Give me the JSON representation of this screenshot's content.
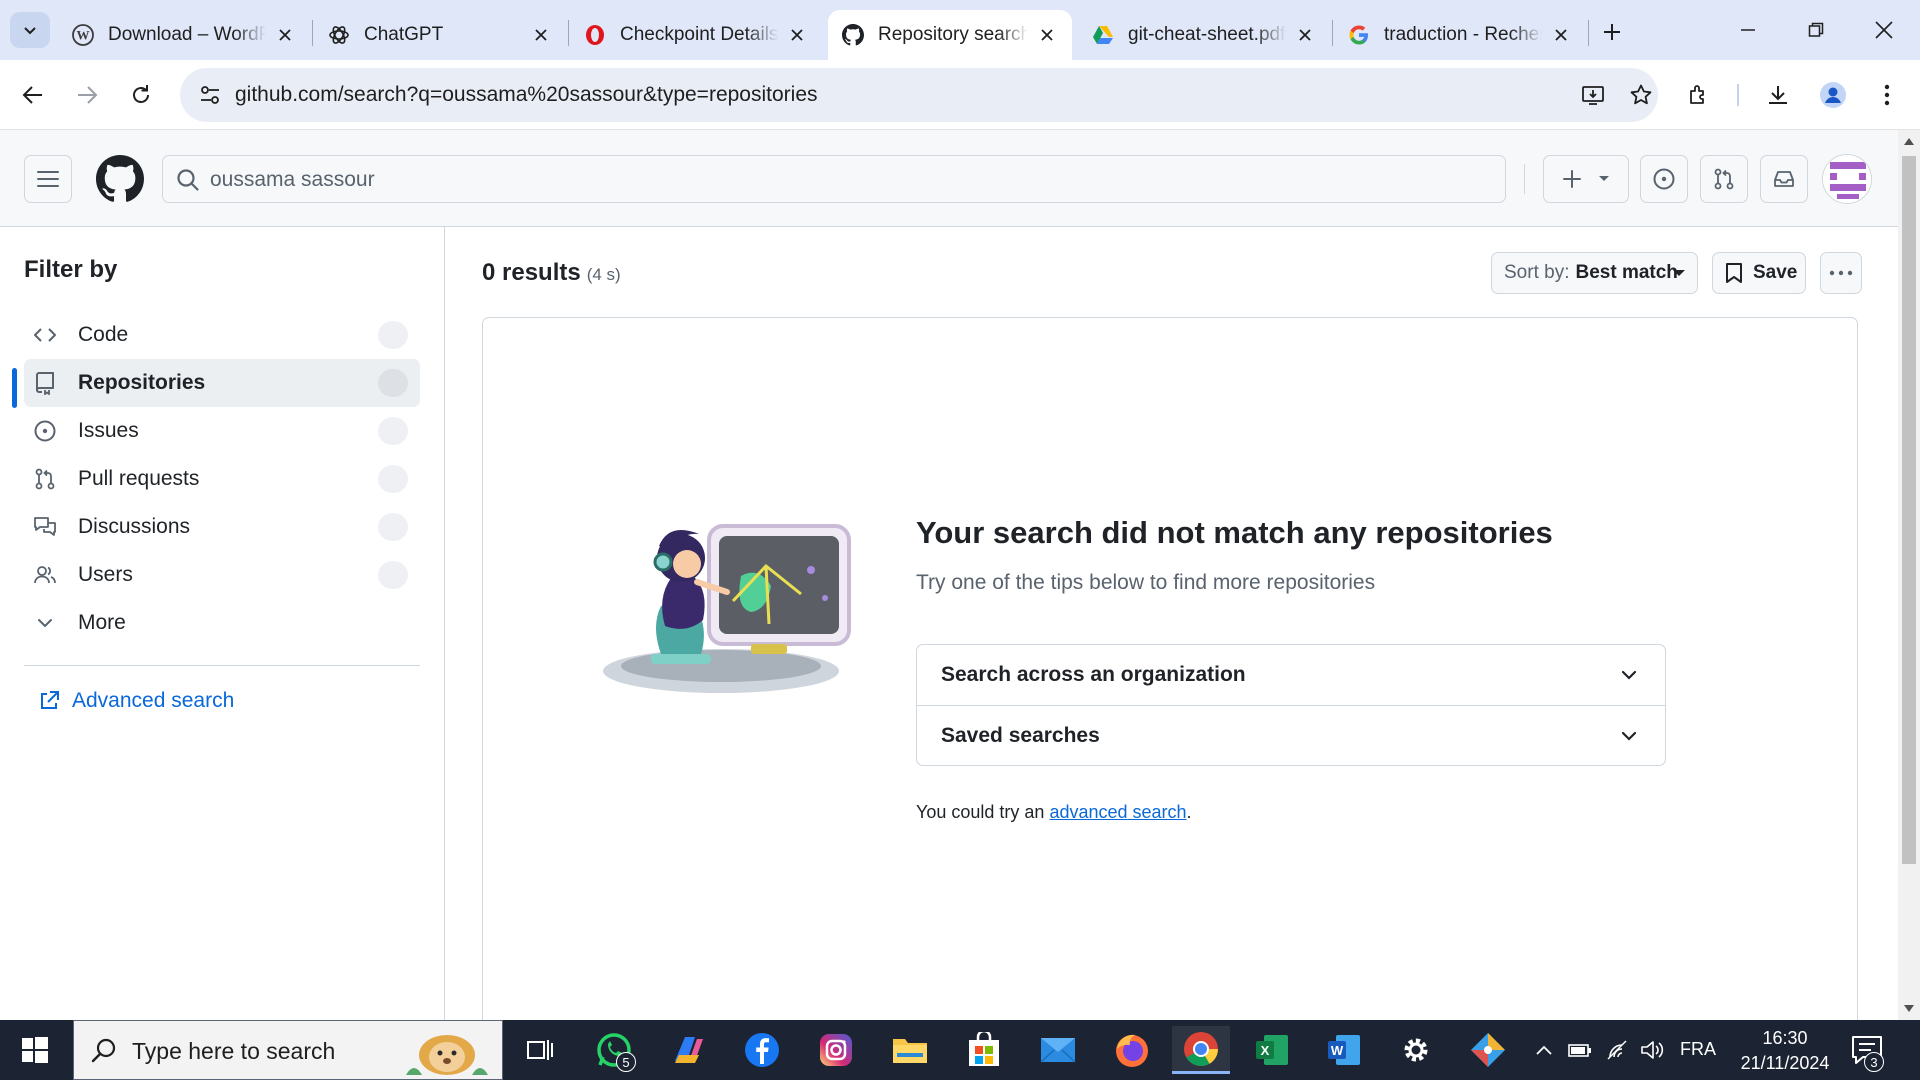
{
  "browser": {
    "tabs": [
      {
        "title": "Download – WordPress",
        "favicon": "wordpress-icon"
      },
      {
        "title": "ChatGPT",
        "favicon": "openai-icon"
      },
      {
        "title": "Checkpoint Details",
        "favicon": "opera-icon"
      },
      {
        "title": "Repository search results",
        "favicon": "github-icon",
        "active": true
      },
      {
        "title": "git-cheat-sheet.pdf",
        "favicon": "google-drive-icon"
      },
      {
        "title": "traduction - Recherche Google",
        "favicon": "google-icon"
      }
    ],
    "url": "github.com/search?q=oussama%20sassour&type=repositories"
  },
  "github": {
    "search_query": "oussama sassour"
  },
  "sidebar": {
    "title": "Filter by",
    "items": [
      {
        "label": "Code",
        "icon": "code-icon"
      },
      {
        "label": "Repositories",
        "icon": "repo-icon",
        "selected": true
      },
      {
        "label": "Issues",
        "icon": "issue-icon"
      },
      {
        "label": "Pull requests",
        "icon": "pull-request-icon"
      },
      {
        "label": "Discussions",
        "icon": "discussions-icon"
      },
      {
        "label": "Users",
        "icon": "users-icon"
      },
      {
        "label": "More",
        "icon": "chevron-down-icon"
      }
    ],
    "advanced_search": "Advanced search"
  },
  "results": {
    "count": "0 results",
    "time": "(4 s)",
    "sort_prefix": "Sort by:",
    "sort_value": "Best match",
    "save_label": "Save"
  },
  "blankslate": {
    "title": "Your search did not match any repositories",
    "subtitle": "Try one of the tips below to find more repositories",
    "accordions": [
      "Search across an organization",
      "Saved searches"
    ],
    "foot_prefix": "You could try an",
    "foot_link": "advanced search",
    "foot_suffix": "."
  },
  "taskbar": {
    "search_placeholder": "Type here to search",
    "whatsapp_badge": "5",
    "language": "FRA",
    "time": "16:30",
    "date": "21/11/2024",
    "notification_count": "3"
  },
  "colors": {
    "accent": "#0969da",
    "tabstrip": "#dfe7f8",
    "taskbar": "#1c2433"
  }
}
